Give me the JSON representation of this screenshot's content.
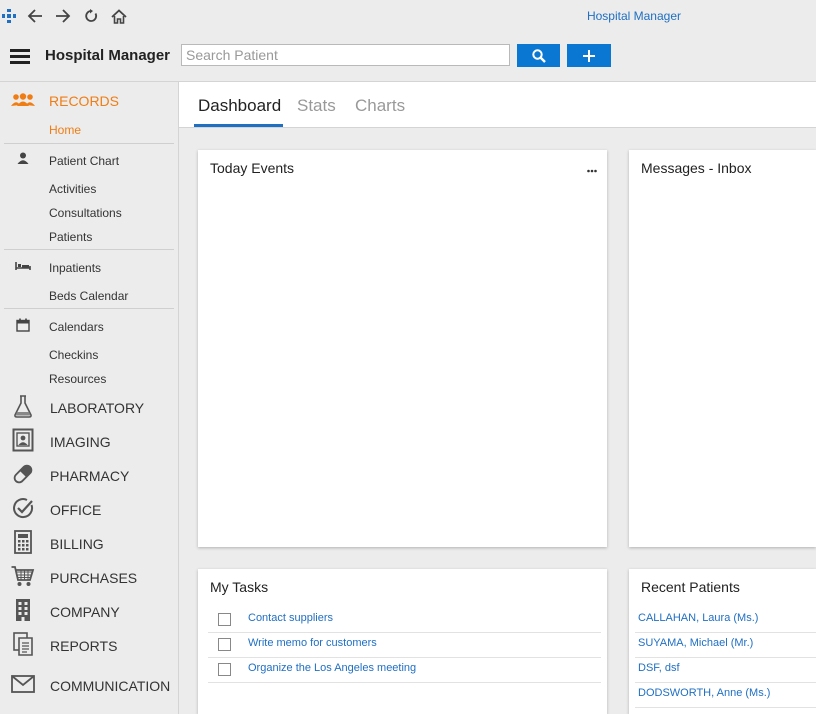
{
  "browser": {
    "title": "Hospital Manager",
    "icons": [
      "app-logo-icon",
      "back-arrow-icon",
      "forward-arrow-icon",
      "reload-icon",
      "home-icon"
    ]
  },
  "header": {
    "app_name": "Hospital Manager",
    "search_placeholder": "Search Patient",
    "search_value": ""
  },
  "sidebar": {
    "records": "RECORDS",
    "home": "Home",
    "patient_chart": "Patient Chart",
    "activities": "Activities",
    "consultations": "Consultations",
    "patients": "Patients",
    "inpatients": "Inpatients",
    "beds_calendar": "Beds Calendar",
    "calendars": "Calendars",
    "checkins": "Checkins",
    "resources": "Resources",
    "laboratory": "LABORATORY",
    "imaging": "IMAGING",
    "pharmacy": "PHARMACY",
    "office": "OFFICE",
    "billing": "BILLING",
    "purchases": "PURCHASES",
    "company": "COMPANY",
    "reports": "REPORTS",
    "communication": "COMMUNICATION"
  },
  "tabs": [
    "Dashboard",
    "Stats",
    "Charts"
  ],
  "panels": {
    "today_events": "Today Events",
    "messages": "Messages - Inbox",
    "tasks_title": "My Tasks",
    "tasks": [
      "Contact suppliers",
      "Write memo for customers",
      "Organize the Los Angeles meeting"
    ],
    "recent_title": "Recent Patients",
    "recent": [
      "CALLAHAN, Laura (Ms.)",
      "SUYAMA, Michael (Mr.)",
      "DSF, dsf",
      "DODSWORTH, Anne (Ms.)"
    ]
  },
  "colors": {
    "accent": "#0a78d2",
    "link": "#1f6fc3",
    "active": "#f07d14",
    "background": "#ececec"
  }
}
